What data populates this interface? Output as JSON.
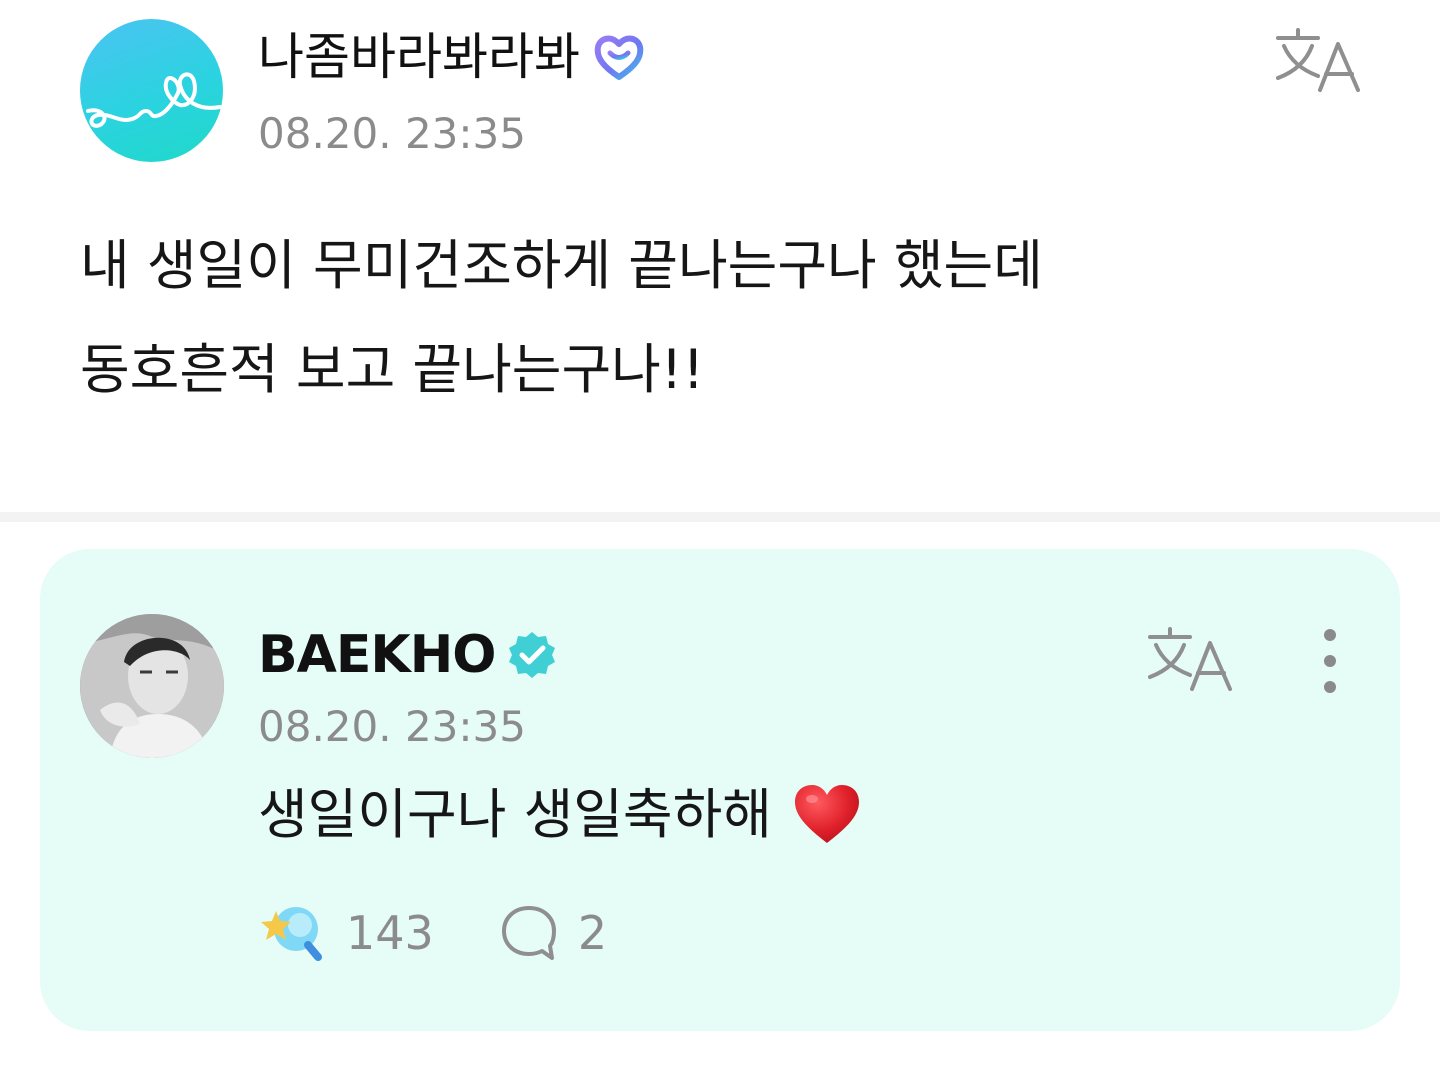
{
  "post": {
    "author": "나좀바라봐라봐",
    "timestamp": "08.20. 23:35",
    "body_lines": [
      "내 생일이 무미건조하게 끝나는구나 했는데",
      "동호흔적 보고 끝나는구나!!"
    ],
    "icons": {
      "badge": "fan-membership-badge-icon",
      "translate": "translate-icon"
    }
  },
  "comment": {
    "author": "BAEKHO",
    "timestamp": "08.20. 23:35",
    "body": "생일이구나 생일축하해",
    "reactions": {
      "likes": "143",
      "comments": "2"
    },
    "icons": {
      "badge": "verified-check-icon",
      "translate": "translate-icon",
      "more": "more-vertical-icon",
      "emoji": "red-heart-icon",
      "like": "star-lightstick-icon",
      "reply": "speech-bubble-icon"
    }
  },
  "colors": {
    "card_background": "#e6fcf6",
    "timestamp": "#8b8b8b",
    "verified": "#3fcfd4",
    "fan_avatar": "#2bd3e0",
    "fan_badge": "#7a6ff0",
    "heart": "#d81e28"
  }
}
